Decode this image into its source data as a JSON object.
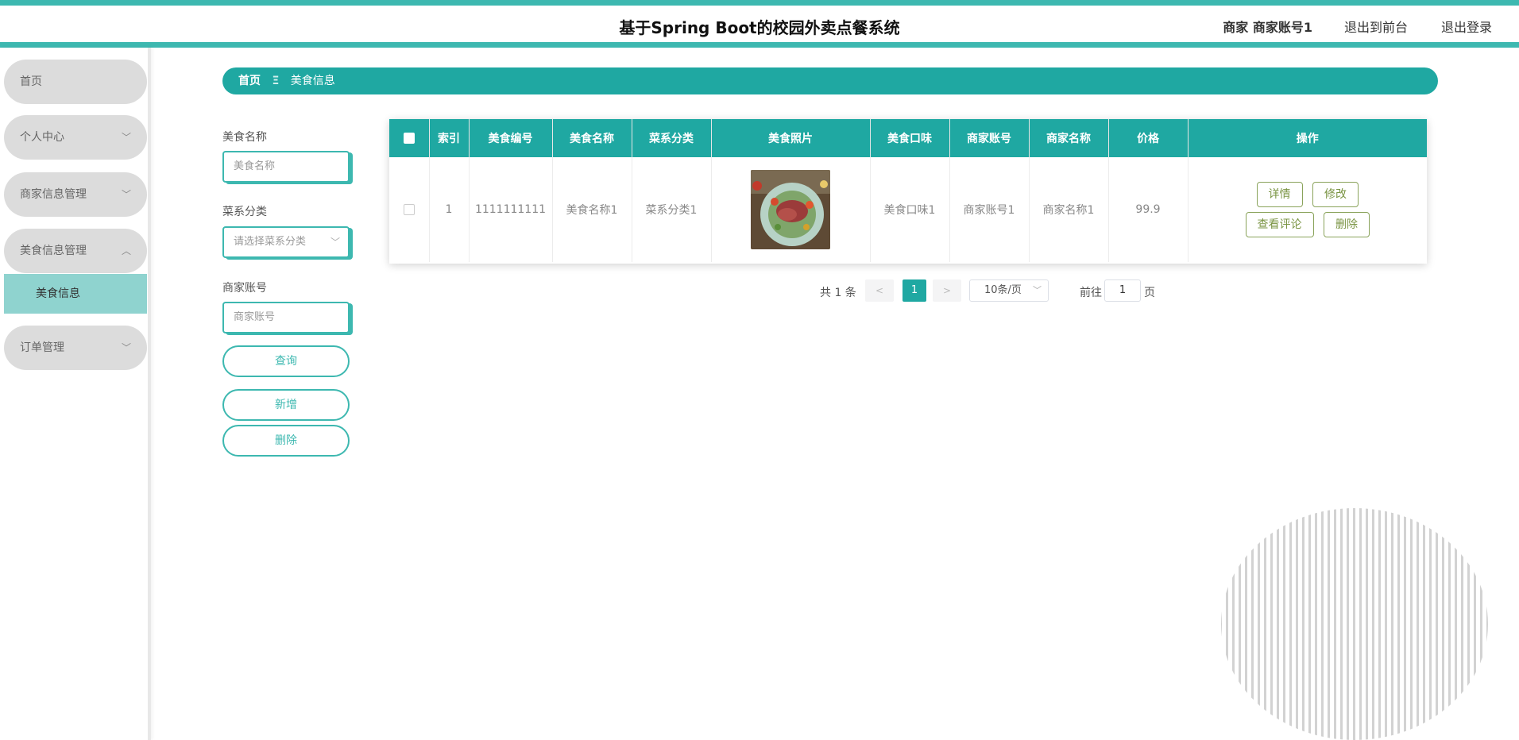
{
  "header": {
    "title": "基于Spring Boot的校园外卖点餐系统",
    "user": "商家 商家账号1",
    "front_label": "退出到前台",
    "logout_label": "退出登录"
  },
  "sidebar": {
    "items": [
      {
        "label": "首页"
      },
      {
        "label": "个人中心"
      },
      {
        "label": "商家信息管理"
      },
      {
        "label": "美食信息管理"
      },
      {
        "label": "订单管理"
      }
    ],
    "subitem": "美食信息"
  },
  "breadcrumb": {
    "home": "首页",
    "separator": "Ξ",
    "current": "美食信息"
  },
  "search": {
    "name_label": "美食名称",
    "name_placeholder": "美食名称",
    "category_label": "菜系分类",
    "category_placeholder": "请选择菜系分类",
    "account_label": "商家账号",
    "account_placeholder": "商家账号",
    "query_btn": "查询",
    "add_btn": "新增",
    "delete_btn": "删除"
  },
  "table": {
    "headers": [
      "索引",
      "美食编号",
      "美食名称",
      "菜系分类",
      "美食照片",
      "美食口味",
      "商家账号",
      "商家名称",
      "价格",
      "操作"
    ],
    "rows": [
      {
        "index": "1",
        "code": "1111111111",
        "name": "美食名称1",
        "category": "菜系分类1",
        "taste": "美食口味1",
        "account": "商家账号1",
        "merchant": "商家名称1",
        "price": "99.9",
        "actions": {
          "detail": "详情",
          "edit": "修改",
          "review": "查看评论",
          "delete": "删除"
        }
      }
    ]
  },
  "pagination": {
    "total": "共 1 条",
    "prev": "<",
    "page": "1",
    "next": ">",
    "page_size": "10条/页",
    "goto_label": "前往",
    "goto_value": "1",
    "page_label": "页"
  },
  "colors": {
    "accent": "#1fa8a2",
    "header_border": "#3db8b0",
    "sidebar_item": "#dcdcdc",
    "sidebar_active": "#8fd3cf",
    "action_button": "#7a9443"
  }
}
